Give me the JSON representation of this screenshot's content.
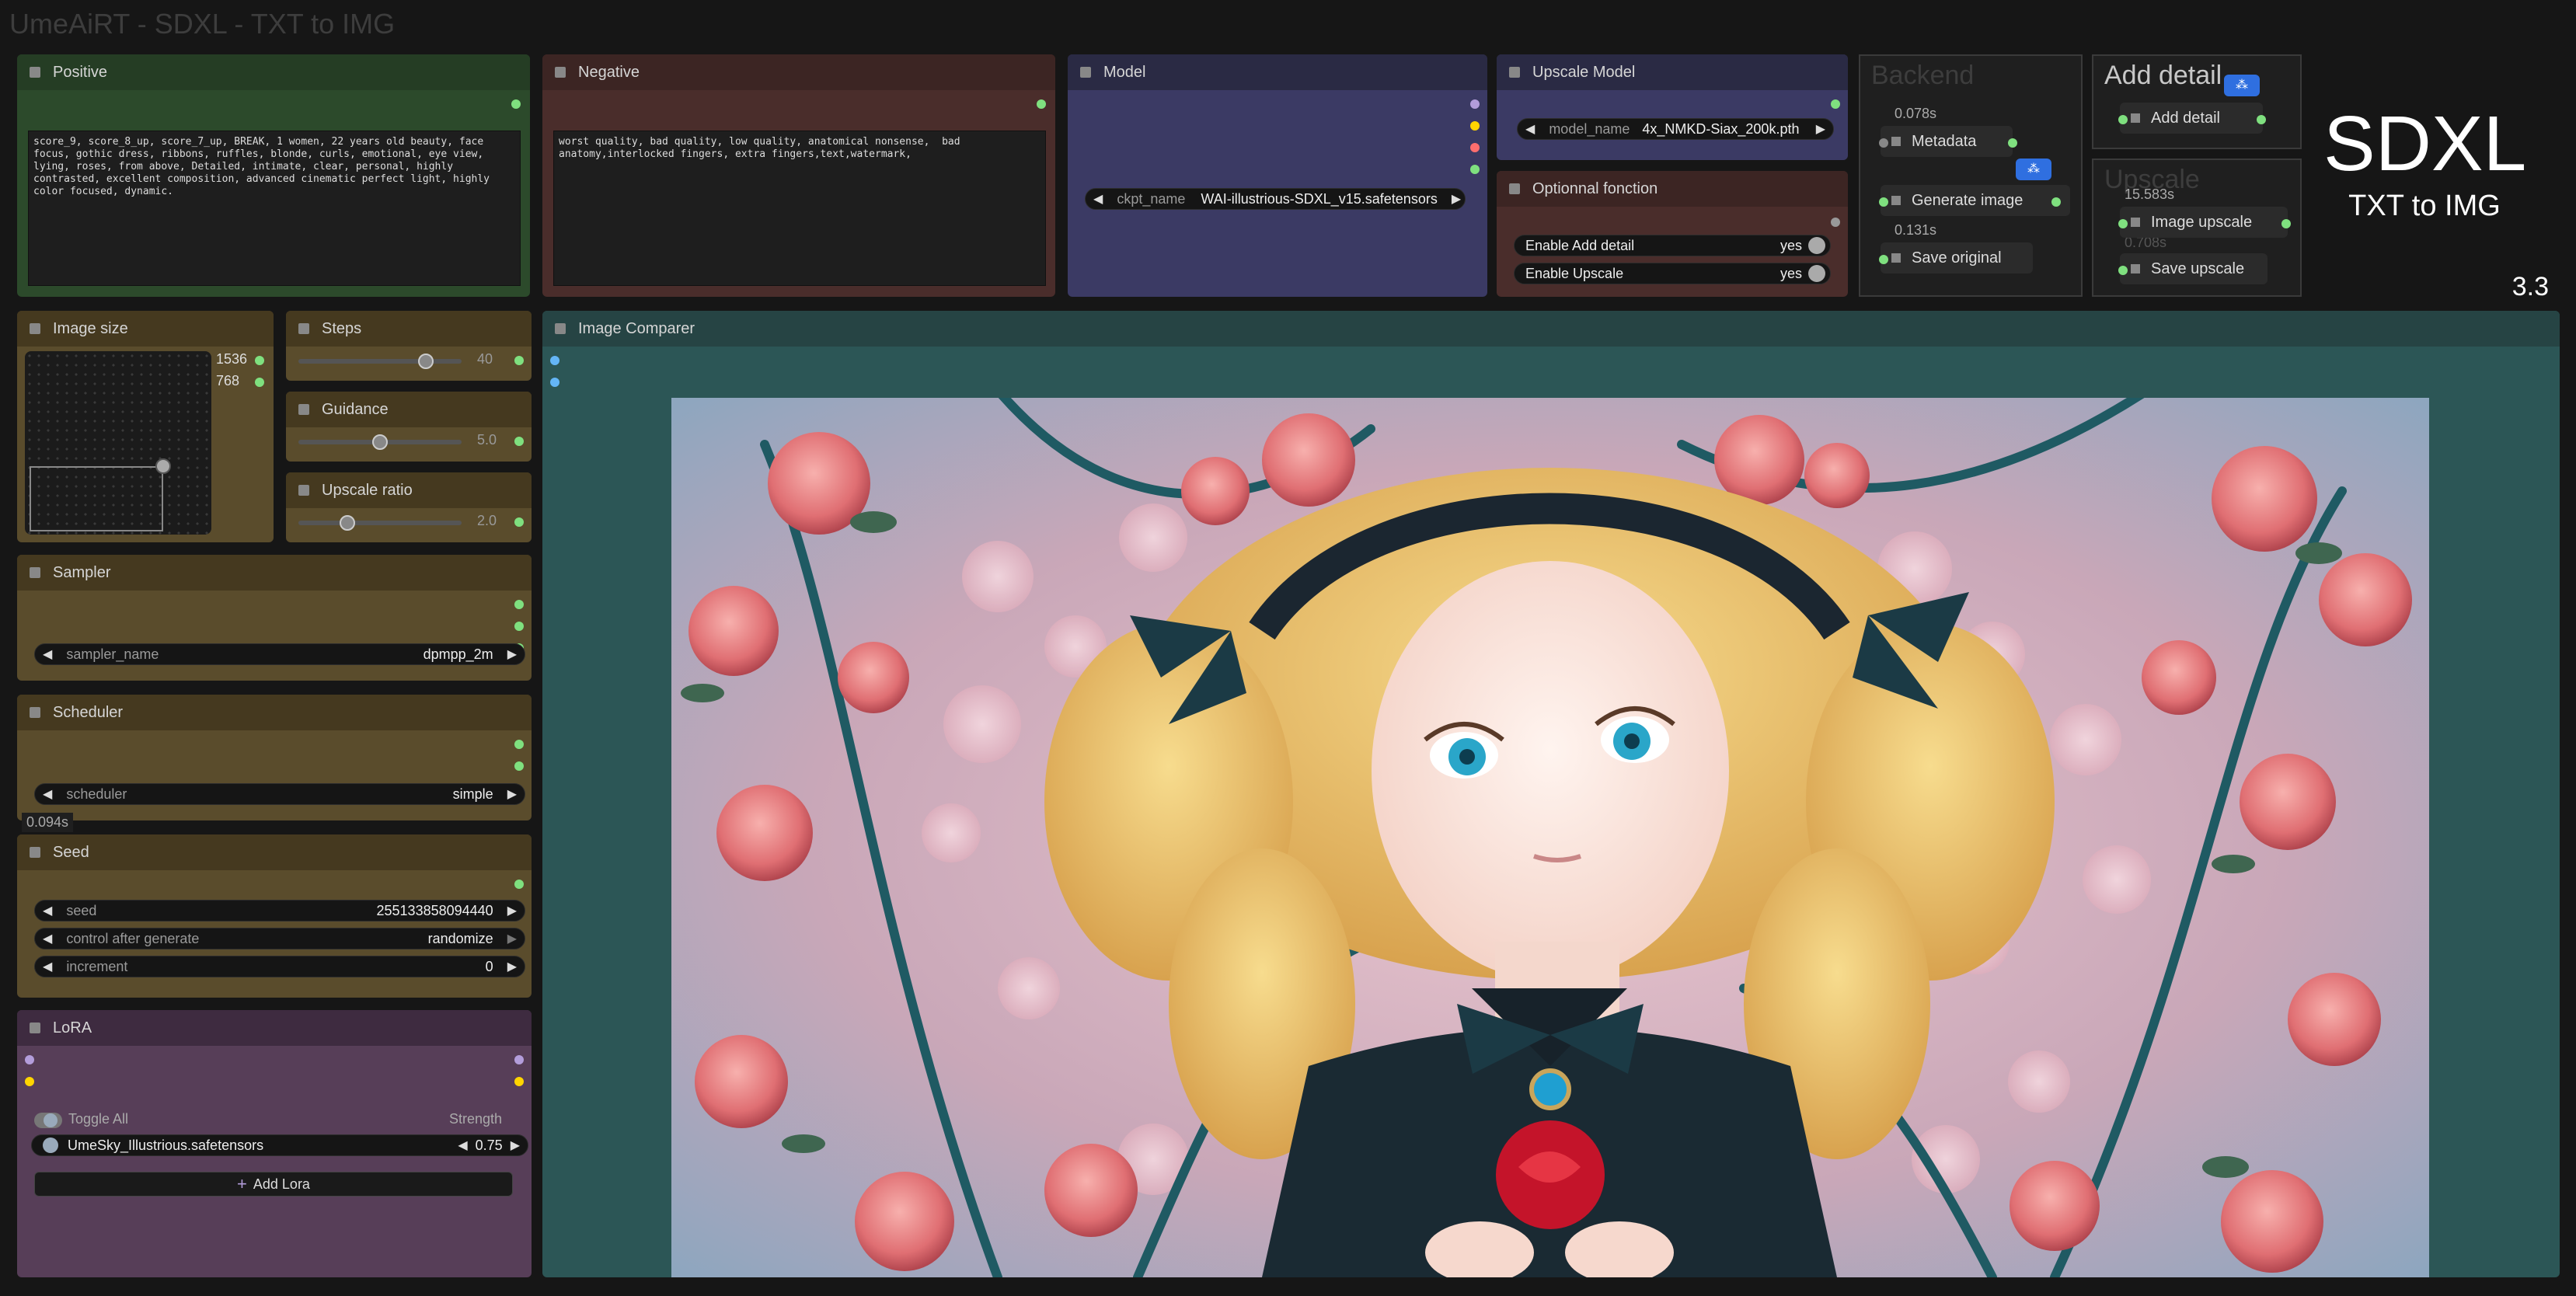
{
  "workflow_title": "UmeAiRT - SDXL - TXT to IMG",
  "branding": {
    "title": "SDXL",
    "subtitle": "TXT to IMG",
    "version": "3.3"
  },
  "positive": {
    "title": "Positive",
    "text": "score_9, score_8_up, score_7_up, BREAK, 1 women, 22 years old beauty, face focus, gothic dress, ribbons, ruffles, blonde, curls, emotional, eye view, lying, roses, from above, Detailed, intimate, clear, personal, highly contrasted, excellent composition, advanced cinematic perfect light, highly color focused, dynamic."
  },
  "negative": {
    "title": "Negative",
    "text": "worst quality, bad quality, low quality, anatomical nonsense,  bad anatomy,interlocked fingers, extra fingers,text,watermark,"
  },
  "model": {
    "title": "Model",
    "ckpt_label": "ckpt_name",
    "ckpt_value": "WAI-illustrious-SDXL_v15.safetensors"
  },
  "upscale_model": {
    "title": "Upscale Model",
    "label": "model_name",
    "value": "4x_NMKD-Siax_200k.pth"
  },
  "optional": {
    "title": "Optionnal fonction",
    "items": [
      {
        "label": "Enable Add detail",
        "value": "yes"
      },
      {
        "label": "Enable Upscale",
        "value": "yes"
      }
    ]
  },
  "backend": {
    "title": "Backend",
    "metadata_time": "0.078s",
    "metadata": "Metadata",
    "generate": "Generate image",
    "generate_time": "0.131s",
    "save_original": "Save original"
  },
  "add_detail": {
    "title": "Add detail",
    "item": "Add detail"
  },
  "upscale": {
    "title": "Upscale",
    "time": "15.583s",
    "ghost_time": "0.708s",
    "item1": "Image upscale",
    "item2": "Save upscale"
  },
  "image_size": {
    "title": "Image size",
    "width": "1536",
    "height": "768"
  },
  "steps": {
    "title": "Steps",
    "value": "40",
    "fraction": 0.78
  },
  "guidance": {
    "title": "Guidance",
    "value": "5.0",
    "fraction": 0.5
  },
  "upscale_ratio": {
    "title": "Upscale ratio",
    "value": "2.0",
    "fraction": 0.3
  },
  "sampler": {
    "title": "Sampler",
    "label": "sampler_name",
    "value": "dpmpp_2m"
  },
  "scheduler": {
    "title": "Scheduler",
    "label": "scheduler",
    "value": "simple",
    "time": "0.094s"
  },
  "seed": {
    "title": "Seed",
    "rows": [
      {
        "label": "seed",
        "value": "255133858094440"
      },
      {
        "label": "control after generate",
        "value": "randomize"
      },
      {
        "label": "increment",
        "value": "0"
      }
    ]
  },
  "lora": {
    "title": "LoRA",
    "toggle_all": "Toggle All",
    "strength_label": "Strength",
    "item_name": "UmeSky_Illustrious.safetensors",
    "item_strength": "0.75",
    "add_button": "Add Lora"
  },
  "image_comparer": {
    "title": "Image Comparer"
  },
  "colors": {
    "positive_body": "#2c4a2b",
    "positive_header": "#253d24",
    "negative_body": "#4a2d2b",
    "negative_header": "#3c2523",
    "model_body": "#3b3a64",
    "model_header": "#2a2a44",
    "node_brown": "#5a4c2c",
    "node_brown_header": "#45391f",
    "lora_body": "#573e58",
    "lora_header": "#3e2b40",
    "comparer_body": "#2c5656",
    "comparer_header": "#264444"
  }
}
